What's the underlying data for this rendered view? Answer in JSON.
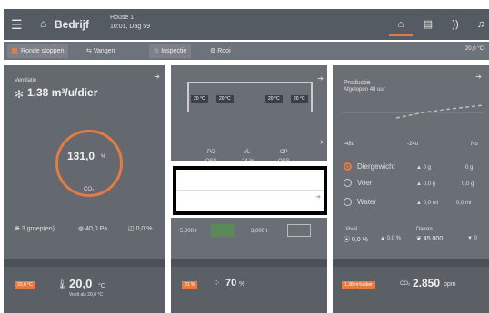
{
  "header": {
    "company": "Bedrijf",
    "house_line1": "House 1",
    "house_line2": "10:01, Dag 59"
  },
  "toolbar": {
    "tabs": [
      "Ronde stoppen",
      "Vangen",
      "Inspectie",
      "Rooi"
    ],
    "right_value": "20,0 °C"
  },
  "ventilation": {
    "title": "Ventilatie",
    "value": "1,38 m³/u/dier",
    "ring_value": "131,0",
    "ring_unit": "%",
    "ring_label": "CO₂",
    "groups": "3 groep(en)",
    "pressure": "40,0 Pa",
    "percent": "0,0 %"
  },
  "drinker": {
    "temps": [
      "20 °C",
      "20 °C",
      "20 °C",
      "20 °C"
    ],
    "bottom_labels": [
      "P/Z",
      "VL",
      "OP"
    ],
    "bottom_sublabels": [
      "OSS",
      "24 %",
      "OSS"
    ]
  },
  "feed": {
    "values": [
      "5,000 t",
      "3,000 t"
    ]
  },
  "production": {
    "title": "Productie",
    "subtitle": "Afgelopen 48 uur",
    "x_labels": [
      "-48u",
      "-24u",
      "Nu"
    ],
    "rows": [
      {
        "label": "Diergewicht",
        "delta": "▲ 0 g",
        "value": "0 g"
      },
      {
        "label": "Voer",
        "delta": "▲ 0,0 g",
        "value": "0,0 g"
      },
      {
        "label": "Water",
        "delta": "▲ 0,0 ml",
        "value": "0,0 ml"
      }
    ],
    "uitval_label": "Uitval",
    "uitval_value": "0,0 %",
    "uitval_delta": "▲ 0,0 %",
    "dieren_label": "Dieren",
    "dieren_value": "45.000",
    "dieren_delta": "▼ 0"
  },
  "bottom": {
    "temp_tag": "20,0 °C",
    "temp_value": "20,0",
    "temp_unit": "°C",
    "temp_sub": "Voelt als 20,0 °C",
    "hum_tag": "81 %",
    "hum_value": "70",
    "hum_unit": "%",
    "co2_tag": "1.38 m³/u/dier",
    "co2_label": "CO₂",
    "co2_value": "2.850",
    "co2_unit": "ppm"
  }
}
